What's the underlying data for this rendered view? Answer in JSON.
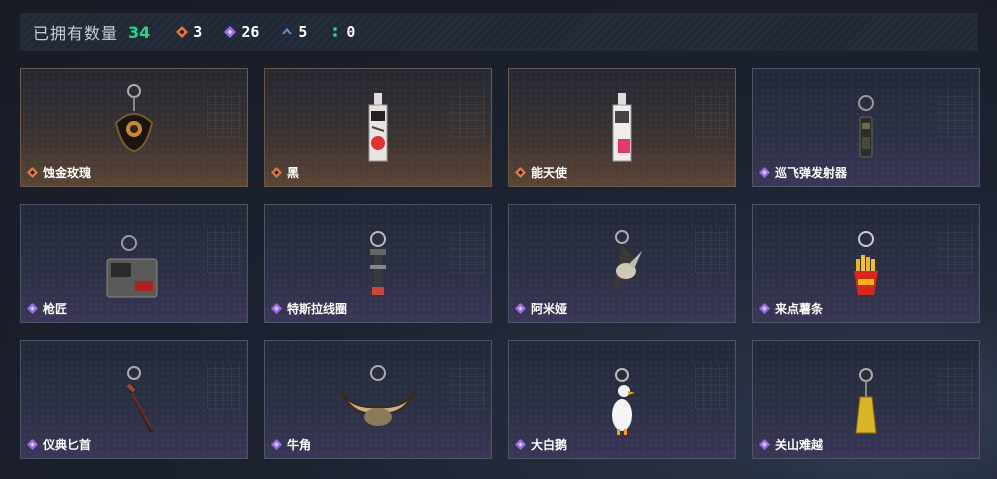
{
  "header": {
    "owned_label": "已拥有数量",
    "owned_total": "34",
    "counters": [
      {
        "icon": "orange-diamond-icon",
        "color": "#e27a3f",
        "value": "3"
      },
      {
        "icon": "purple-diamond-icon",
        "color": "#9b6cf0",
        "value": "26"
      },
      {
        "icon": "blue-chevron-icon",
        "color": "#4f93e0",
        "value": "5"
      },
      {
        "icon": "green-dots-icon",
        "color": "#2bd59a",
        "value": "0"
      }
    ]
  },
  "items": [
    {
      "name": "蚀金玫瑰",
      "rarity": "orange",
      "icon": "rose-keychain-icon"
    },
    {
      "name": "黑",
      "rarity": "orange",
      "icon": "tag-keychain-icon"
    },
    {
      "name": "能天使",
      "rarity": "orange",
      "icon": "tag-keychain-icon"
    },
    {
      "name": "巡飞弹发射器",
      "rarity": "purple",
      "icon": "launcher-keychain-icon"
    },
    {
      "name": "枪匠",
      "rarity": "purple",
      "icon": "toolbox-keychain-icon"
    },
    {
      "name": "特斯拉线圈",
      "rarity": "purple",
      "icon": "coil-keychain-icon"
    },
    {
      "name": "阿米娅",
      "rarity": "purple",
      "icon": "bunny-keychain-icon"
    },
    {
      "name": "来点薯条",
      "rarity": "purple",
      "icon": "fries-keychain-icon"
    },
    {
      "name": "仪典匕首",
      "rarity": "purple",
      "icon": "dagger-keychain-icon"
    },
    {
      "name": "牛角",
      "rarity": "purple",
      "icon": "horn-keychain-icon"
    },
    {
      "name": "大白鹅",
      "rarity": "purple",
      "icon": "goose-keychain-icon"
    },
    {
      "name": "关山难越",
      "rarity": "purple",
      "icon": "gold-bar-keychain-icon"
    }
  ],
  "colors": {
    "orange": "#e27a3f",
    "purple": "#9b6cf0",
    "green": "#27d88a"
  }
}
